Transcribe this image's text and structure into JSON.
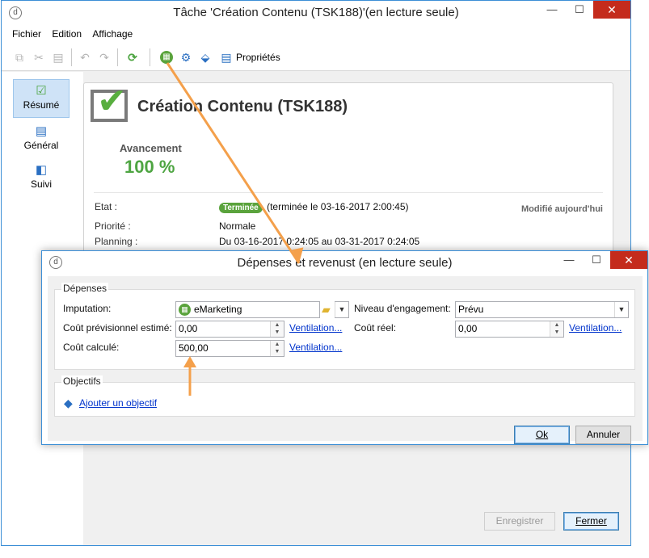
{
  "main_window": {
    "title": "Tâche 'Création Contenu (TSK188)'(en lecture seule)",
    "app_icon_glyph": "d",
    "controls": {
      "minimize": "—",
      "maximize": "☐",
      "close": "✕"
    }
  },
  "menu": {
    "items": [
      "Fichier",
      "Edition",
      "Affichage"
    ]
  },
  "toolbar": {
    "properties_label": "Propriétés",
    "icons": [
      "copy-icon",
      "cut-icon",
      "paste-icon",
      "undo-icon",
      "redo-icon",
      "refresh-icon",
      "budget-icon",
      "settings-icon",
      "workflow-icon",
      "properties-icon"
    ]
  },
  "sidebar": {
    "items": [
      {
        "label": "Résumé",
        "icon": "summary-check-icon",
        "active": true
      },
      {
        "label": "Général",
        "icon": "clipboard-icon",
        "active": false
      },
      {
        "label": "Suivi",
        "icon": "tracking-icon",
        "active": false
      }
    ]
  },
  "summary": {
    "task_title": "Création Contenu (TSK188)",
    "progress_label": "Avancement",
    "progress_value": "100 %",
    "state_label": "Etat :",
    "state_badge": "Terminée",
    "state_detail": "(terminée le 03-16-2017 2:00:45)",
    "modified": "Modifié aujourd'hui",
    "priority_label": "Priorité :",
    "priority_value": "Normale",
    "planning_label": "Planning :",
    "planning_value": "Du 03-16-2017 0:24:05 au 03-31-2017 0:24:05"
  },
  "bottom_buttons": {
    "save": "Enregistrer",
    "close": "Fermer"
  },
  "dialog": {
    "title": "Dépenses et revenust (en lecture seule)",
    "controls": {
      "minimize": "—",
      "maximize": "☐",
      "close": "✕"
    },
    "expenses": {
      "legend": "Dépenses",
      "imputation_label": "Imputation:",
      "imputation_value": "eMarketing",
      "engagement_label": "Niveau d'engagement:",
      "engagement_value": "Prévu",
      "estimated_label": "Coût prévisionnel estimé:",
      "estimated_value": "0,00",
      "real_label": "Coût réel:",
      "real_value": "0,00",
      "calculated_label": "Coût calculé:",
      "calculated_value": "500,00",
      "ventilation_link": "Ventilation..."
    },
    "objectives": {
      "legend": "Objectifs",
      "add_link": "Ajouter un objectif"
    },
    "ok": "Ok",
    "cancel": "Annuler"
  },
  "colors": {
    "accent_arrow": "#f4a04b",
    "success": "#58ae3f",
    "link": "#0033cc",
    "window_border": "#3c8fd6"
  }
}
